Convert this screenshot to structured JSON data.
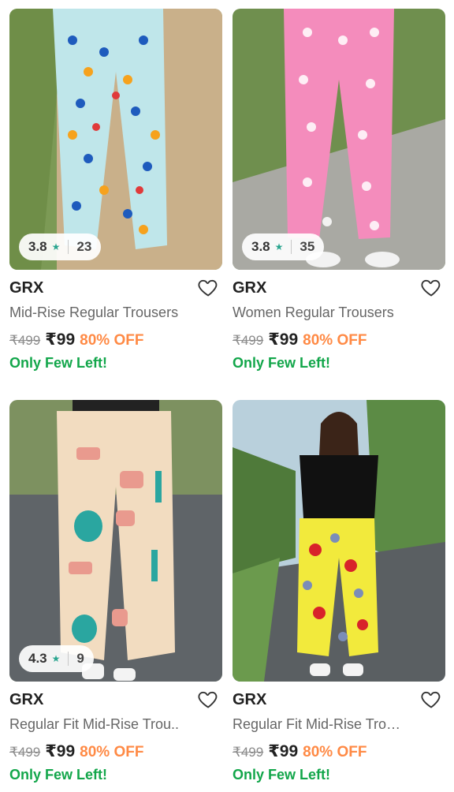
{
  "products": [
    {
      "brand": "GRX",
      "title": "Mid-Rise Regular Trousers",
      "mrp": "₹499",
      "price": "₹99",
      "discount": "80% OFF",
      "stock": "Only Few Left!",
      "rating": "3.8",
      "rating_count": "23",
      "image_desc_icon": "trouser-photo-icon",
      "colors": {
        "pant": "#bfe6ea",
        "bg": "#c9b08a"
      }
    },
    {
      "brand": "GRX",
      "title": "Women Regular Trousers",
      "mrp": "₹499",
      "price": "₹99",
      "discount": "80% OFF",
      "stock": "Only Few Left!",
      "rating": "3.8",
      "rating_count": "35",
      "image_desc_icon": "trouser-photo-icon",
      "colors": {
        "pant": "#f48cbc",
        "bg": "#6f8f4e"
      }
    },
    {
      "brand": "GRX",
      "title": "Regular Fit Mid-Rise Trou..",
      "mrp": "₹499",
      "price": "₹99",
      "discount": "80% OFF",
      "stock": "Only Few Left!",
      "rating": "4.3",
      "rating_count": "9",
      "image_desc_icon": "trouser-photo-icon",
      "colors": {
        "pant": "#f2dcc0",
        "bg": "#5f6468"
      }
    },
    {
      "brand": "GRX",
      "title": "Regular Fit Mid-Rise Tro…",
      "mrp": "₹499",
      "price": "₹99",
      "discount": "80% OFF",
      "stock": "Only Few Left!",
      "image_desc_icon": "trouser-photo-icon",
      "colors": {
        "pant": "#f2ea3c",
        "bg": "#5a5f62"
      }
    }
  ],
  "theme": {
    "discount_color": "#ff8a45",
    "stock_color": "#12a64a",
    "rating_star_color": "#2aa58f"
  }
}
